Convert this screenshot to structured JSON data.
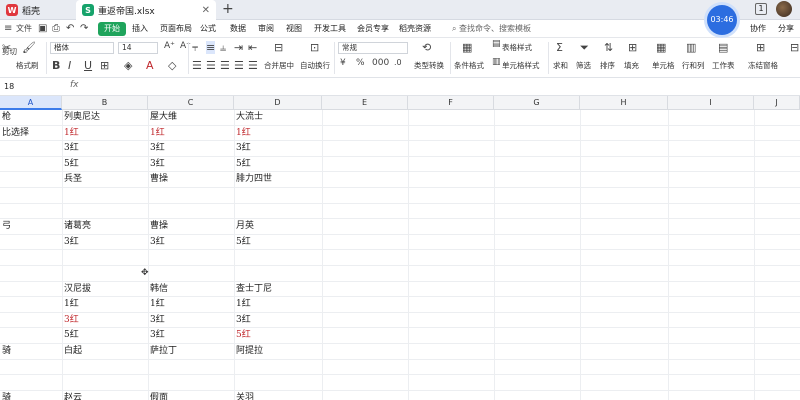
{
  "titlebar": {
    "tab1": "稻壳",
    "tab2": "重返帝国.xlsx",
    "plus": "+",
    "badge": "1"
  },
  "menubar": {
    "start": "开始",
    "items": [
      "插入",
      "页面布局",
      "公式",
      "数据",
      "审阅",
      "视图",
      "开发工具",
      "会员专享",
      "稻壳资源"
    ],
    "search": "查找命令、搜索模板",
    "clock": "03:46",
    "collab": "协作",
    "share": "分享"
  },
  "ribbon": {
    "cut": "剪切",
    "format_painter": "格式刷",
    "font_name": "楷体",
    "font_size": "14",
    "merge": "合并居中",
    "wrap": "自动换行",
    "number_format": "常规",
    "convert": "类型转换",
    "cond_format": "条件格式",
    "table_style": "表格样式",
    "cell_style": "单元格样式",
    "sum": "求和",
    "filter": "筛选",
    "sort": "排序",
    "fill": "填充",
    "cell": "单元格",
    "rowcol": "行和列",
    "sheet": "工作表",
    "freeze": "冻结窗格"
  },
  "formula": {
    "cellref": "18",
    "fx": "fx"
  },
  "columns": [
    "A",
    "B",
    "C",
    "D",
    "E",
    "F",
    "G",
    "H",
    "I",
    "J"
  ],
  "rows": [
    [
      "枪",
      "列奥尼达",
      "屋大维",
      "大流士"
    ],
    [
      "比选择",
      "1红",
      "1红",
      "1红"
    ],
    [
      "",
      "3红",
      "3红",
      "3红"
    ],
    [
      "",
      "5红",
      "3红",
      "5红"
    ],
    [
      "",
      "兵圣",
      "曹操",
      "腓力四世"
    ],
    [
      "",
      "",
      "",
      ""
    ],
    [
      "",
      "",
      "",
      ""
    ],
    [
      "弓",
      "诸葛亮",
      "曹操",
      "月英"
    ],
    [
      "",
      "3红",
      "3红",
      "5红"
    ],
    [
      "",
      "",
      "",
      ""
    ],
    [
      "",
      "",
      "",
      ""
    ],
    [
      "",
      "汉尼拔",
      "韩信",
      "查士丁尼"
    ],
    [
      "",
      "1红",
      "1红",
      "1红"
    ],
    [
      "",
      "3红",
      "3红",
      "3红"
    ],
    [
      "",
      "5红",
      "3红",
      "5红"
    ],
    [
      "骑",
      "白起",
      "萨拉丁",
      "阿提拉"
    ],
    [
      "",
      "",
      "",
      ""
    ],
    [
      "",
      "",
      "",
      ""
    ],
    [
      "骑",
      "赵云",
      "假面",
      "关羽"
    ]
  ],
  "red_cells": [
    "1-1",
    "1-2",
    "1-3",
    "13-1",
    "14-3"
  ],
  "colors": {
    "accent": "#1fa45c",
    "red_text": "#c0282d",
    "select_blue": "#3b7bea"
  }
}
